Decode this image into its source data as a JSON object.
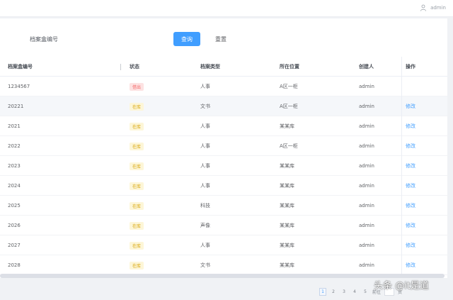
{
  "header": {
    "user_name": "admin",
    "colors": {
      "background": "#ffffff"
    }
  },
  "search": {
    "label": "档案盒编号",
    "query_label": "查询",
    "reset_label": "重置"
  },
  "table": {
    "columns": [
      "档案盒编号",
      "状态",
      "档案类型",
      "所在位置",
      "创建人",
      "操作"
    ],
    "rows": [
      {
        "code": "1234567",
        "status": "借出",
        "status_type": "danger",
        "type": "人事",
        "location": "A区一柜",
        "creator": "admin",
        "action": ""
      },
      {
        "code": "20221",
        "status": "在库",
        "status_type": "warning",
        "type": "文书",
        "location": "A区一柜",
        "creator": "admin",
        "action": "修改"
      },
      {
        "code": "2021",
        "status": "在库",
        "status_type": "warning",
        "type": "人事",
        "location": "某某库",
        "creator": "admin",
        "action": "修改"
      },
      {
        "code": "2022",
        "status": "在库",
        "status_type": "warning",
        "type": "人事",
        "location": "A区一柜",
        "creator": "admin",
        "action": "修改"
      },
      {
        "code": "2023",
        "status": "在库",
        "status_type": "warning",
        "type": "人事",
        "location": "某某库",
        "creator": "admin",
        "action": "修改"
      },
      {
        "code": "2024",
        "status": "在库",
        "status_type": "warning",
        "type": "人事",
        "location": "某某库",
        "creator": "admin",
        "action": "修改"
      },
      {
        "code": "2025",
        "status": "在库",
        "status_type": "warning",
        "type": "科技",
        "location": "某某库",
        "creator": "admin",
        "action": "修改"
      },
      {
        "code": "2026",
        "status": "在库",
        "status_type": "warning",
        "type": "声像",
        "location": "某某库",
        "creator": "admin",
        "action": "修改"
      },
      {
        "code": "2027",
        "status": "在库",
        "status_type": "warning",
        "type": "人事",
        "location": "某某库",
        "creator": "admin",
        "action": "修改"
      },
      {
        "code": "2028",
        "status": "在库",
        "status_type": "warning",
        "type": "文书",
        "location": "某某库",
        "creator": "admin",
        "action": "修改"
      }
    ]
  },
  "pagination": {
    "pages": [
      "1",
      "2",
      "3",
      "4",
      "5"
    ],
    "current": "1",
    "goto_label": "前往",
    "page_suffix": "页"
  },
  "watermark": "头条 @it是道",
  "colors": {
    "primary": "#409eff",
    "danger": "#f56c6c",
    "warning": "#e6a23c",
    "hover_row": "#f5f7fa"
  }
}
